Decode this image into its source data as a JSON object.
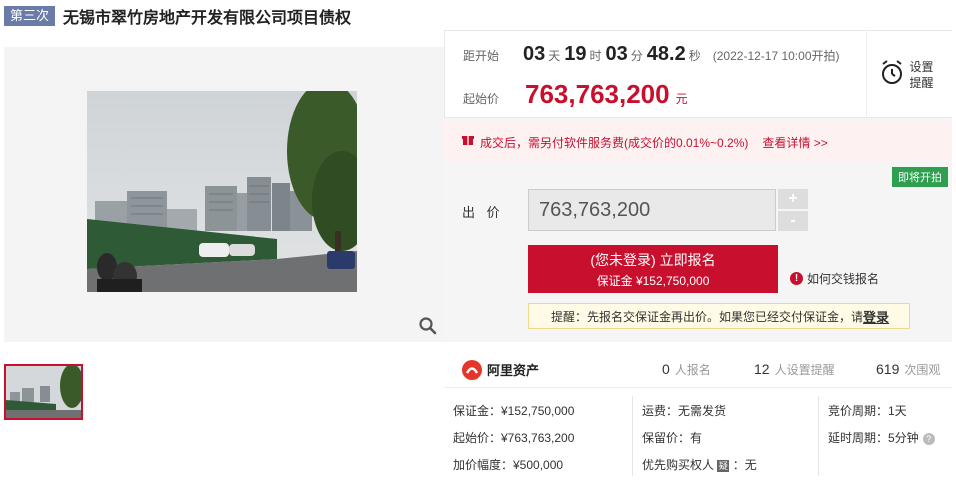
{
  "header": {
    "round_badge": "第三次",
    "title": "无锡市翠竹房地产开发有限公司项目债权"
  },
  "countdown": {
    "label": "距开始",
    "days": "03",
    "days_unit": "天",
    "hours": "19",
    "hours_unit": "时",
    "minutes": "03",
    "minutes_unit": "分",
    "seconds": "48.2",
    "seconds_unit": "秒",
    "start_time": "(2022-12-17 10:00开拍)"
  },
  "reminder": {
    "label": "设置提醒",
    "icon": "alarm-clock-icon"
  },
  "starting_price": {
    "label": "起始价",
    "value": "763,763,200",
    "unit": "元"
  },
  "fee_notice": {
    "text": "成交后，需另付软件服务费(成交价的0.01%~0.2%)",
    "link": "查看详情 >>",
    "icon": "gift-icon"
  },
  "status_badge": "即将开拍",
  "bid": {
    "label": "出 价",
    "value": "763,763,200",
    "plus": "+",
    "minus": "-"
  },
  "signup": {
    "main": "(您未登录) 立即报名",
    "deposit": "保证金 ¥152,750,000",
    "how_link": "如何交钱报名"
  },
  "tip": {
    "text": "提醒：先报名交保证金再出价。如果您已经交付保证金，请",
    "link": "登录"
  },
  "brand": {
    "name": "阿里资产"
  },
  "stats": {
    "signups_num": "0",
    "signups_label": "人报名",
    "reminders_num": "12",
    "reminders_label": "人设置提醒",
    "views_num": "619",
    "views_label": "次围观"
  },
  "details": {
    "deposit": "保证金：¥152,750,000",
    "start_price": "起始价：¥763,763,200",
    "increment": "加价幅度：¥500,000",
    "shipping": "运费：无需发货",
    "reserve_price": "保留价：有",
    "priority_label": "优先购买权人",
    "priority_value": "：无",
    "priority_icon_char": "疑",
    "bid_cycle": "竞价周期：1天",
    "delay_cycle": "延时周期：5分钟"
  },
  "colors": {
    "accent": "#c8102e",
    "badge_green": "#2e9e4f",
    "round_badge": "#6b7ba8"
  }
}
